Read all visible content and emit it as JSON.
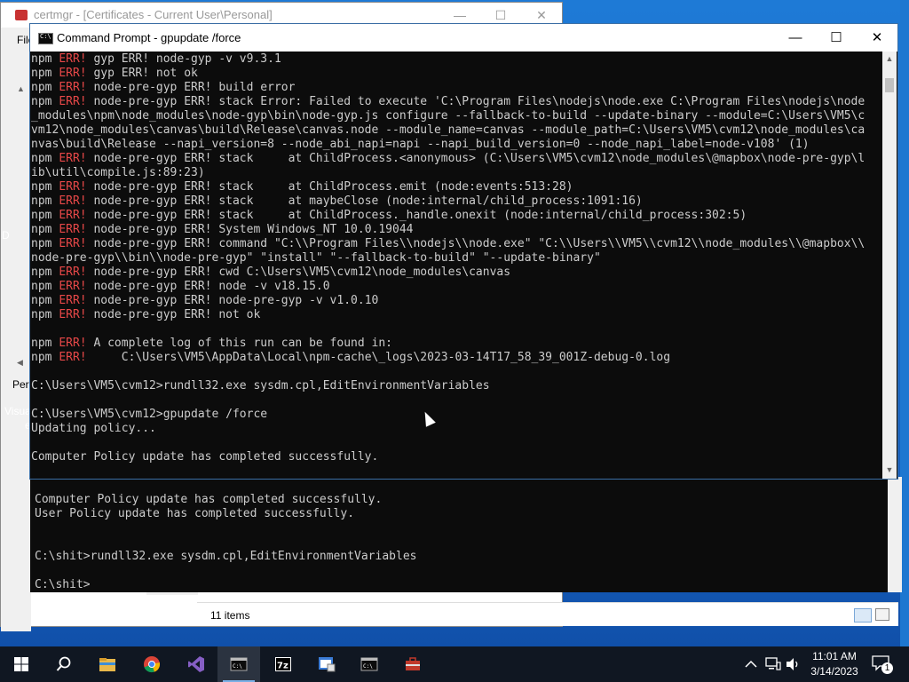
{
  "certmgr": {
    "title": "certmgr - [Certificates - Current User\\Personal]",
    "menu_partial": "File",
    "pane_label_partial": "Pers",
    "status_items": "11 items",
    "controls": {
      "minimize": "—",
      "maximize": "☐",
      "close": "✕"
    }
  },
  "desktop": {
    "icon_label_partial": "Visua",
    "icon_label_partial2": "e",
    "left_letter": "D"
  },
  "cmd": {
    "title": "Command Prompt - gpupdate  /force",
    "controls": {
      "minimize": "—",
      "maximize": "☐",
      "close": "✕"
    },
    "lines": [
      {
        "p": "npm ",
        "e": "ERR!",
        "t": " gyp ERR! node-gyp -v v9.3.1"
      },
      {
        "p": "npm ",
        "e": "ERR!",
        "t": " gyp ERR! not ok"
      },
      {
        "p": "npm ",
        "e": "ERR!",
        "t": " node-pre-gyp ERR! build error"
      },
      {
        "p": "npm ",
        "e": "ERR!",
        "t": " node-pre-gyp ERR! stack Error: Failed to execute 'C:\\Program Files\\nodejs\\node.exe C:\\Program Files\\nodejs\\node"
      },
      {
        "p": "_modules\\npm\\node_modules\\node-gyp\\bin\\node-gyp.js configure --fallback-to-build --update-binary --module=C:\\Users\\VM5\\c",
        "e": "",
        "t": ""
      },
      {
        "p": "vm12\\node_modules\\canvas\\build\\Release\\canvas.node --module_name=canvas --module_path=C:\\Users\\VM5\\cvm12\\node_modules\\ca",
        "e": "",
        "t": ""
      },
      {
        "p": "nvas\\build\\Release --napi_version=8 --node_abi_napi=napi --napi_build_version=0 --node_napi_label=node-v108' (1)",
        "e": "",
        "t": ""
      },
      {
        "p": "npm ",
        "e": "ERR!",
        "t": " node-pre-gyp ERR! stack     at ChildProcess.<anonymous> (C:\\Users\\VM5\\cvm12\\node_modules\\@mapbox\\node-pre-gyp\\l"
      },
      {
        "p": "ib\\util\\compile.js:89:23)",
        "e": "",
        "t": ""
      },
      {
        "p": "npm ",
        "e": "ERR!",
        "t": " node-pre-gyp ERR! stack     at ChildProcess.emit (node:events:513:28)"
      },
      {
        "p": "npm ",
        "e": "ERR!",
        "t": " node-pre-gyp ERR! stack     at maybeClose (node:internal/child_process:1091:16)"
      },
      {
        "p": "npm ",
        "e": "ERR!",
        "t": " node-pre-gyp ERR! stack     at ChildProcess._handle.onexit (node:internal/child_process:302:5)"
      },
      {
        "p": "npm ",
        "e": "ERR!",
        "t": " node-pre-gyp ERR! System Windows_NT 10.0.19044"
      },
      {
        "p": "npm ",
        "e": "ERR!",
        "t": " node-pre-gyp ERR! command \"C:\\\\Program Files\\\\nodejs\\\\node.exe\" \"C:\\\\Users\\\\VM5\\\\cvm12\\\\node_modules\\\\@mapbox\\\\"
      },
      {
        "p": "node-pre-gyp\\\\bin\\\\node-pre-gyp\" \"install\" \"--fallback-to-build\" \"--update-binary\"",
        "e": "",
        "t": ""
      },
      {
        "p": "npm ",
        "e": "ERR!",
        "t": " node-pre-gyp ERR! cwd C:\\Users\\VM5\\cvm12\\node_modules\\canvas"
      },
      {
        "p": "npm ",
        "e": "ERR!",
        "t": " node-pre-gyp ERR! node -v v18.15.0"
      },
      {
        "p": "npm ",
        "e": "ERR!",
        "t": " node-pre-gyp ERR! node-pre-gyp -v v1.0.10"
      },
      {
        "p": "npm ",
        "e": "ERR!",
        "t": " node-pre-gyp ERR! not ok"
      },
      {
        "p": "",
        "e": "",
        "t": ""
      },
      {
        "p": "npm ",
        "e": "ERR!",
        "t": " A complete log of this run can be found in:"
      },
      {
        "p": "npm ",
        "e": "ERR!",
        "t": "     C:\\Users\\VM5\\AppData\\Local\\npm-cache\\_logs\\2023-03-14T17_58_39_001Z-debug-0.log"
      },
      {
        "p": "",
        "e": "",
        "t": ""
      },
      {
        "p": "C:\\Users\\VM5\\cvm12>rundll32.exe sysdm.cpl,EditEnvironmentVariables",
        "e": "",
        "t": ""
      },
      {
        "p": "",
        "e": "",
        "t": ""
      },
      {
        "p": "C:\\Users\\VM5\\cvm12>gpupdate /force",
        "e": "",
        "t": ""
      },
      {
        "p": "Updating policy...",
        "e": "",
        "t": ""
      },
      {
        "p": "",
        "e": "",
        "t": ""
      },
      {
        "p": "Computer Policy update has completed successfully.",
        "e": "",
        "t": ""
      }
    ]
  },
  "cmd2": {
    "text": "Computer Policy update has completed successfully.\nUser Policy update has completed successfully.\n\n\nC:\\shit>rundll32.exe sysdm.cpl,EditEnvironmentVariables\n\nC:\\shit>"
  },
  "taskbar": {
    "apps": [
      "start",
      "search",
      "file-explorer",
      "chrome",
      "visual-studio",
      "command-prompt",
      "7zip",
      "certmgr-mmc",
      "command-prompt-2",
      "toolbox-app"
    ],
    "time": "11:01 AM",
    "date": "3/14/2023",
    "notification_count": "1"
  }
}
